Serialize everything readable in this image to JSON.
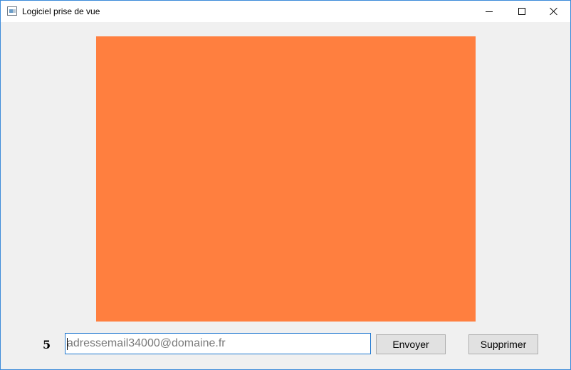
{
  "window": {
    "title": "Logiciel prise de vue",
    "icon": "app-window-icon",
    "controls": [
      "minimize-icon",
      "maximize-icon",
      "close-icon"
    ]
  },
  "camera_view": {
    "color": "#ff7f3f"
  },
  "counter": {
    "value": "5"
  },
  "email": {
    "value": "",
    "placeholder": "adressemail34000@domaine.fr"
  },
  "buttons": {
    "send_label": "Envoyer",
    "delete_label": "Supprimer"
  },
  "colors": {
    "accent_border": "#1f77d0",
    "window_background": "#f0f0f0"
  }
}
